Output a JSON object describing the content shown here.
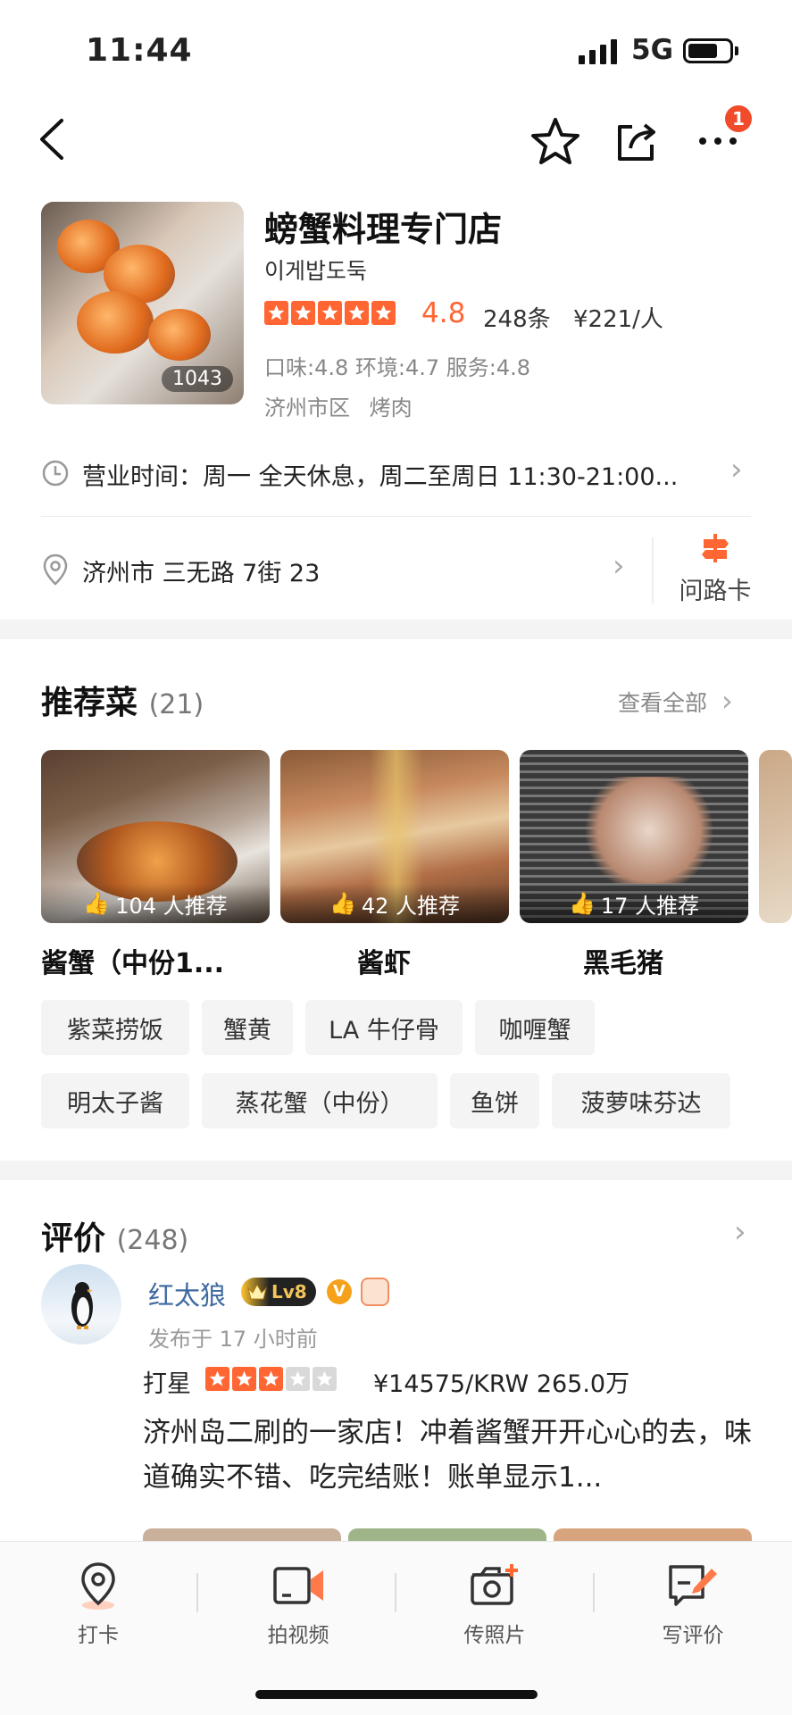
{
  "status_bar": {
    "time": "11:44",
    "network": "5G"
  },
  "nav": {
    "badge_count": "1"
  },
  "shop": {
    "name": "螃蟹料理专门店",
    "subtitle": "이게밥도둑",
    "photo_count": "1043",
    "rating": "4.8",
    "review_count": "248条",
    "price": "¥221/人",
    "subscores": "口味:4.8 环境:4.7 服务:4.8",
    "area": "济州市区",
    "category": "烤肉",
    "accent": "#ff6633"
  },
  "hours": {
    "text": "营业时间：周一 全天休息，周二至周日 11:30-21:00..."
  },
  "address": {
    "text": "济州市 三无路 7街 23",
    "route_card_label": "问路卡"
  },
  "recommended": {
    "title": "推荐菜",
    "count": "(21)",
    "see_all": "查看全部",
    "dishes": [
      {
        "name": "酱蟹（中份1...",
        "recommend": "104 人推荐"
      },
      {
        "name": "酱虾",
        "recommend": "42 人推荐"
      },
      {
        "name": "黑毛猪",
        "recommend": "17 人推荐"
      }
    ],
    "tags": [
      "紫菜捞饭",
      "蟹黄",
      "LA 牛仔骨",
      "咖喱蟹",
      "明太子酱",
      "蒸花蟹（中份）",
      "鱼饼",
      "菠萝味芬达"
    ]
  },
  "reviews": {
    "title": "评价",
    "count": "(248)",
    "first": {
      "user": "红太狼",
      "level": "Lv8",
      "v_badge": "V",
      "posted": "发布于 17 小时前",
      "rating_label": "打星",
      "stars": 3,
      "price_text": "¥14575/KRW 265.0万",
      "text": "济州岛二刷的一家店！冲着酱蟹开开心心的去，味道确实不错、吃完结账！账单显示1..."
    }
  },
  "tabbar": {
    "items": [
      {
        "label": "打卡",
        "icon": "location-pin-icon"
      },
      {
        "label": "拍视频",
        "icon": "video-icon"
      },
      {
        "label": "传照片",
        "icon": "camera-add-icon"
      },
      {
        "label": "写评价",
        "icon": "write-review-icon"
      }
    ]
  }
}
